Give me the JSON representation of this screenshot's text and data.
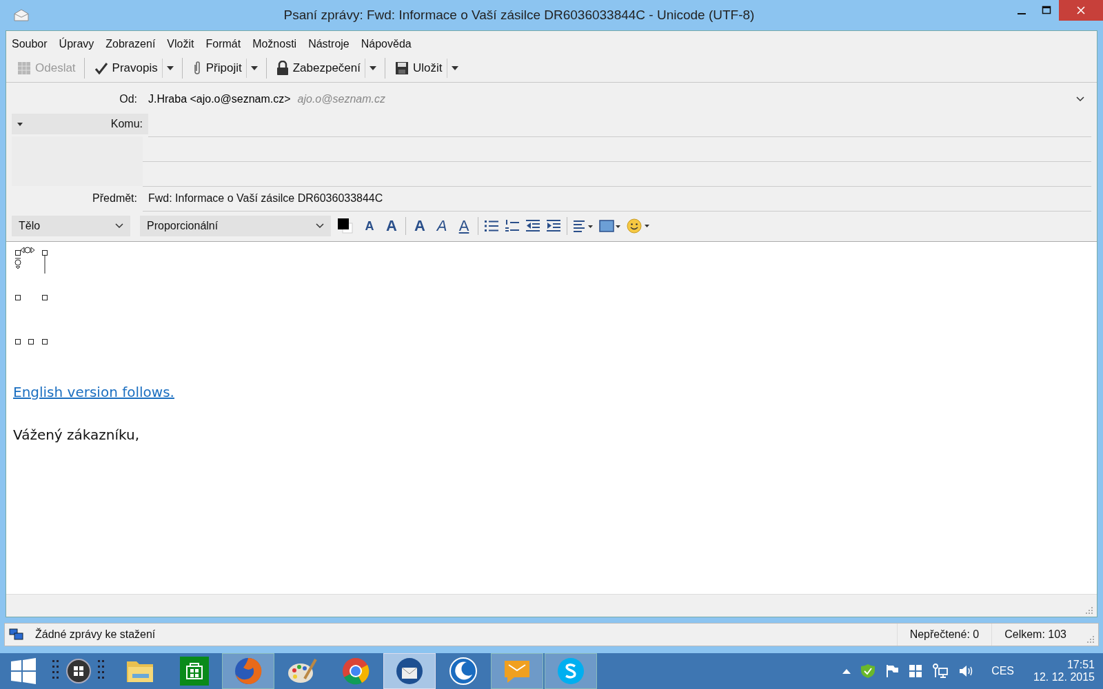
{
  "window": {
    "title": "Psaní zprávy: Fwd: Informace o Vaší zásilce DR6036033844C - Unicode (UTF-8)"
  },
  "menu": [
    "Soubor",
    "Úpravy",
    "Zobrazení",
    "Vložit",
    "Formát",
    "Možnosti",
    "Nástroje",
    "Nápověda"
  ],
  "toolbar": [
    {
      "kind": "send",
      "label": "Odeslat",
      "disabled": true,
      "dropdown": false
    },
    {
      "kind": "spell",
      "label": "Pravopis",
      "disabled": false,
      "dropdown": true
    },
    {
      "kind": "attach",
      "label": "Připojit",
      "disabled": false,
      "dropdown": true
    },
    {
      "kind": "security",
      "label": "Zabezpečení",
      "disabled": false,
      "dropdown": true
    },
    {
      "kind": "save",
      "label": "Uložit",
      "disabled": false,
      "dropdown": true
    }
  ],
  "header": {
    "from": {
      "label": "Od:",
      "value": "J.Hraba <ajo.o@seznam.cz>",
      "identity": "ajo.o@seznam.cz"
    },
    "to": {
      "label": "Komu:"
    },
    "subject": {
      "label": "Předmět:",
      "value": "Fwd: Informace o Vaší zásilce DR6036033844C"
    }
  },
  "format_bar": {
    "paragraph": "Tělo",
    "font": "Proporcionální",
    "buttons": [
      {
        "kind": "smaller",
        "glyph": "A"
      },
      {
        "kind": "larger",
        "glyph": "A"
      },
      {
        "kind": "bold",
        "glyph": "A"
      },
      {
        "kind": "italic",
        "glyph": "A"
      },
      {
        "kind": "underline",
        "glyph": "A"
      },
      {
        "kind": "bullets"
      },
      {
        "kind": "numbers"
      },
      {
        "kind": "outdent"
      },
      {
        "kind": "indent"
      },
      {
        "kind": "align"
      },
      {
        "kind": "image"
      },
      {
        "kind": "emoji"
      }
    ]
  },
  "body": {
    "link": "English version follows.",
    "greeting": "Vážený zákazníku,"
  },
  "status_bar": {
    "message": "Žádné zprávy ke stažení",
    "unread": "Nepřečtené: 0",
    "total": "Celkem: 103"
  },
  "taskbar": {
    "apps": [
      {
        "kind": "explorer",
        "running": false,
        "selected": false
      },
      {
        "kind": "store",
        "running": false,
        "selected": false
      },
      {
        "kind": "firefox",
        "running": true,
        "selected": false
      },
      {
        "kind": "paint",
        "running": false,
        "selected": false
      },
      {
        "kind": "chrome",
        "running": false,
        "selected": false
      },
      {
        "kind": "thunderbird",
        "running": true,
        "selected": true
      },
      {
        "kind": "moon",
        "running": false,
        "selected": false
      },
      {
        "kind": "mail",
        "running": true,
        "selected": false
      },
      {
        "kind": "skype",
        "running": true,
        "selected": false
      }
    ],
    "language": "CES",
    "time": "17:51",
    "date": "12. 12. 2015"
  }
}
